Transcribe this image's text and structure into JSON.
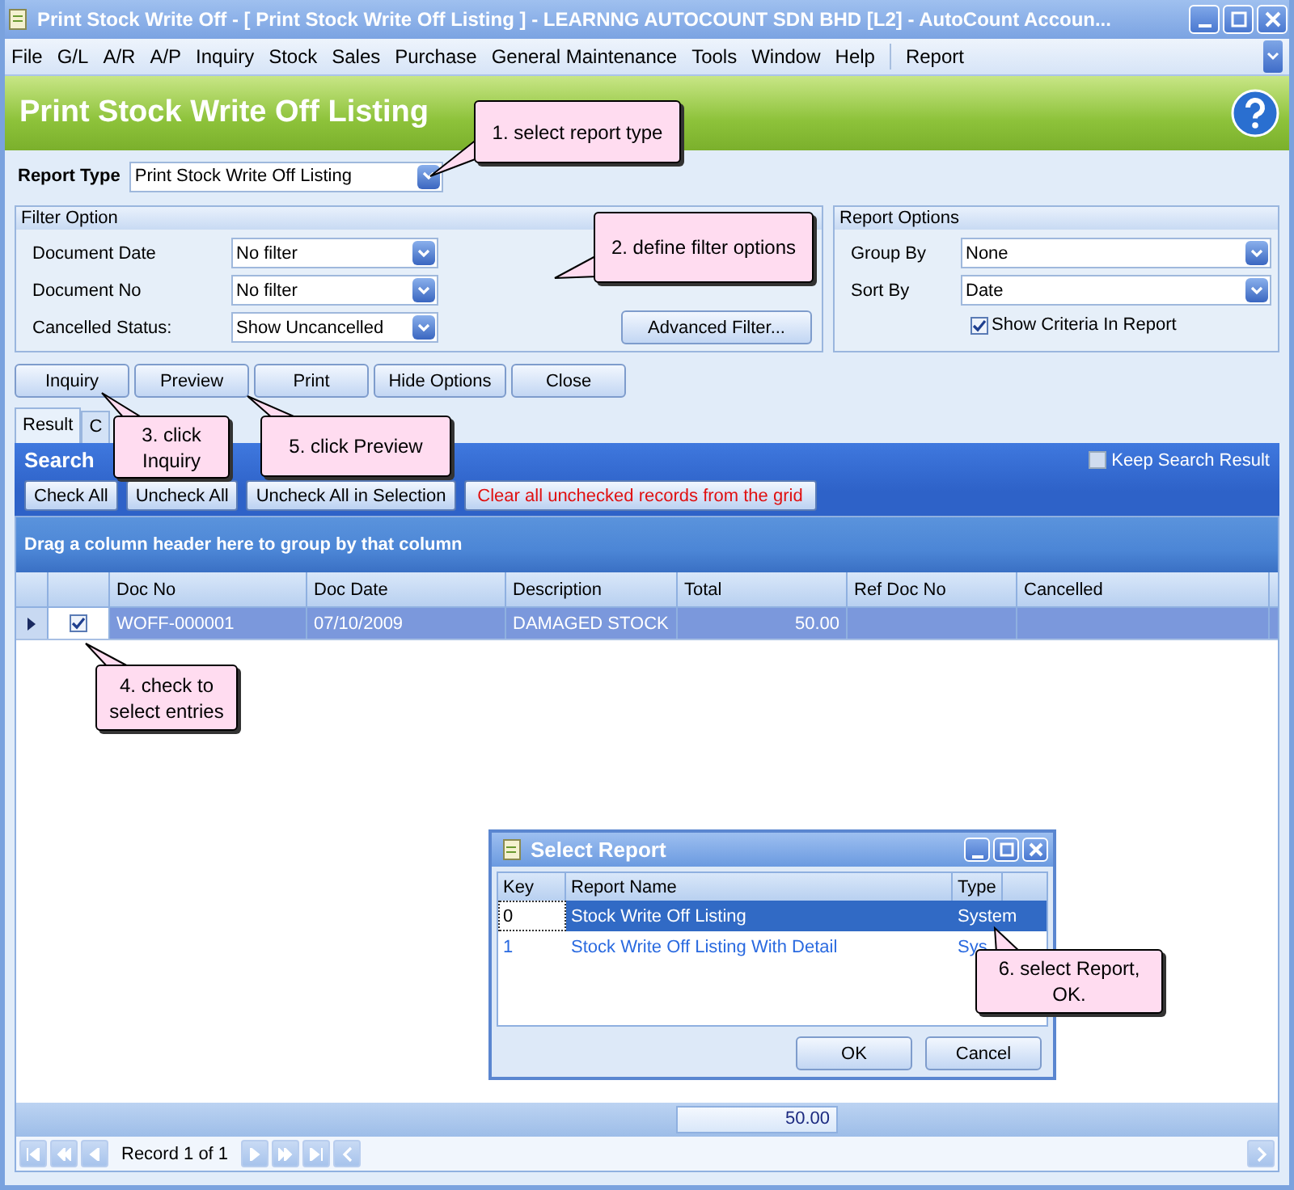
{
  "window": {
    "title": "Print Stock Write Off - [ Print Stock Write Off Listing ] - LEARNNG AUTOCOUNT SDN BHD [L2] - AutoCount Accoun..."
  },
  "menu": {
    "items": [
      "File",
      "G/L",
      "A/R",
      "A/P",
      "Inquiry",
      "Stock",
      "Sales",
      "Purchase",
      "General Maintenance",
      "Tools",
      "Window",
      "Help",
      "Report"
    ]
  },
  "header": {
    "title": "Print Stock Write Off Listing"
  },
  "report_type": {
    "label": "Report Type",
    "value": "Print Stock Write Off Listing"
  },
  "filter_option": {
    "title": "Filter Option",
    "rows": [
      {
        "label": "Document Date",
        "value": "No filter"
      },
      {
        "label": "Document No",
        "value": "No filter"
      },
      {
        "label": "Cancelled Status:",
        "value": "Show Uncancelled"
      }
    ],
    "advanced_button": "Advanced Filter..."
  },
  "report_options": {
    "title": "Report Options",
    "group_by": {
      "label": "Group By",
      "value": "None"
    },
    "sort_by": {
      "label": "Sort By",
      "value": "Date"
    },
    "show_criteria": {
      "label": "Show Criteria In Report",
      "checked": true
    }
  },
  "action_buttons": [
    "Inquiry",
    "Preview",
    "Print",
    "Hide Options",
    "Close"
  ],
  "tabs": [
    {
      "label": "Result",
      "selected": true
    },
    {
      "label": "C",
      "selected": false
    }
  ],
  "search_panel": {
    "title": "Search",
    "keep_search_result": {
      "label": "Keep Search Result",
      "checked": false
    },
    "buttons": [
      {
        "label": "Check All",
        "kind": "normal"
      },
      {
        "label": "Uncheck All",
        "kind": "normal"
      },
      {
        "label": "Uncheck All in Selection",
        "kind": "normal"
      },
      {
        "label": "Clear all unchecked records from the grid",
        "kind": "warning"
      }
    ]
  },
  "grid": {
    "group_hint": "Drag a column header here to group by that column",
    "columns": [
      "Doc No",
      "Doc Date",
      "Description",
      "Total",
      "Ref Doc No",
      "Cancelled"
    ],
    "rows": [
      {
        "checked": true,
        "selected": true,
        "cells": [
          "WOFF-000001",
          "07/10/2009",
          "DAMAGED STOCK",
          "50.00",
          "",
          ""
        ]
      }
    ]
  },
  "footer": {
    "total": "50.00"
  },
  "navigator": {
    "record_text": "Record 1 of 1"
  },
  "dialog": {
    "title": "Select Report",
    "columns": [
      "Key",
      "Report Name",
      "Type"
    ],
    "rows": [
      {
        "key": "0",
        "name": "Stock Write Off Listing",
        "type": "System",
        "selected": true
      },
      {
        "key": "1",
        "name": "Stock Write Off Listing With Detail",
        "type": "Sys",
        "selected": false
      }
    ],
    "buttons": [
      "OK",
      "Cancel"
    ]
  },
  "callouts": [
    {
      "text": "1. select report type"
    },
    {
      "text": "2. define filter options"
    },
    {
      "text": "3. click Inquiry"
    },
    {
      "text": "4. check to select entries"
    },
    {
      "text": "5. click Preview"
    },
    {
      "text": "6. select Report, OK."
    }
  ]
}
